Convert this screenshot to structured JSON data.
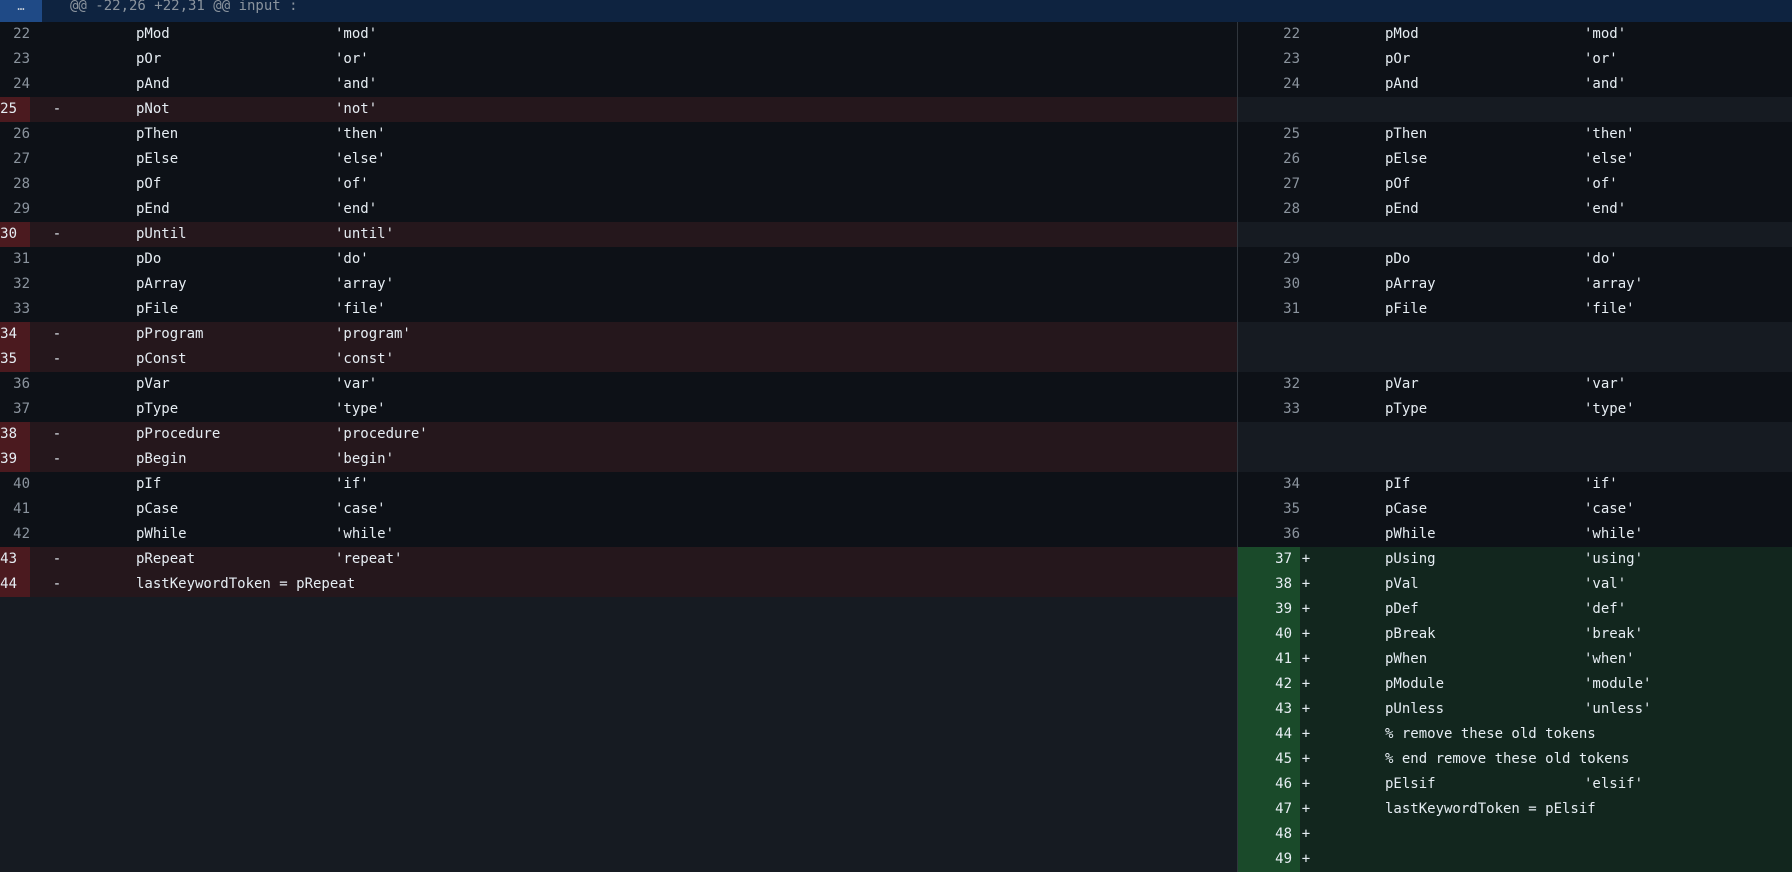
{
  "hunk": {
    "expand_icon": "…",
    "header": "@@ -22,26 +22,31 @@ input :"
  },
  "left": {
    "rows": [
      {
        "ln": "22",
        "mark": "",
        "tok": "pMod",
        "str": "'mod'",
        "type": "ctx"
      },
      {
        "ln": "23",
        "mark": "",
        "tok": "pOr",
        "str": "'or'",
        "type": "ctx"
      },
      {
        "ln": "24",
        "mark": "",
        "tok": "pAnd",
        "str": "'and'",
        "type": "ctx"
      },
      {
        "ln": "25",
        "mark": "-",
        "tok": "pNot",
        "str": "'not'",
        "type": "del"
      },
      {
        "ln": "26",
        "mark": "",
        "tok": "pThen",
        "str": "'then'",
        "type": "ctx"
      },
      {
        "ln": "27",
        "mark": "",
        "tok": "pElse",
        "str": "'else'",
        "type": "ctx"
      },
      {
        "ln": "28",
        "mark": "",
        "tok": "pOf",
        "str": "'of'",
        "type": "ctx"
      },
      {
        "ln": "29",
        "mark": "",
        "tok": "pEnd",
        "str": "'end'",
        "type": "ctx"
      },
      {
        "ln": "30",
        "mark": "-",
        "tok": "pUntil",
        "str": "'until'",
        "type": "del"
      },
      {
        "ln": "31",
        "mark": "",
        "tok": "pDo",
        "str": "'do'",
        "type": "ctx"
      },
      {
        "ln": "32",
        "mark": "",
        "tok": "pArray",
        "str": "'array'",
        "type": "ctx"
      },
      {
        "ln": "33",
        "mark": "",
        "tok": "pFile",
        "str": "'file'",
        "type": "ctx"
      },
      {
        "ln": "34",
        "mark": "-",
        "tok": "pProgram",
        "str": "'program'",
        "type": "del"
      },
      {
        "ln": "35",
        "mark": "-",
        "tok": "pConst",
        "str": "'const'",
        "type": "del"
      },
      {
        "ln": "36",
        "mark": "",
        "tok": "pVar",
        "str": "'var'",
        "type": "ctx"
      },
      {
        "ln": "37",
        "mark": "",
        "tok": "pType",
        "str": "'type'",
        "type": "ctx"
      },
      {
        "ln": "38",
        "mark": "-",
        "tok": "pProcedure",
        "str": "'procedure'",
        "type": "del"
      },
      {
        "ln": "39",
        "mark": "-",
        "tok": "pBegin",
        "str": "'begin'",
        "type": "del"
      },
      {
        "ln": "40",
        "mark": "",
        "tok": "pIf",
        "str": "'if'",
        "type": "ctx"
      },
      {
        "ln": "41",
        "mark": "",
        "tok": "pCase",
        "str": "'case'",
        "type": "ctx"
      },
      {
        "ln": "42",
        "mark": "",
        "tok": "pWhile",
        "str": "'while'",
        "type": "ctx"
      },
      {
        "ln": "43",
        "mark": "-",
        "tok": "pRepeat",
        "str": "'repeat'",
        "type": "del"
      },
      {
        "ln": "44",
        "mark": "-",
        "tok": "lastKeywordToken = pRepeat",
        "str": "",
        "type": "del"
      }
    ]
  },
  "right": {
    "rows": [
      {
        "ln": "22",
        "mark": "",
        "tok": "pMod",
        "str": "'mod'",
        "type": "ctx"
      },
      {
        "ln": "23",
        "mark": "",
        "tok": "pOr",
        "str": "'or'",
        "type": "ctx"
      },
      {
        "ln": "24",
        "mark": "",
        "tok": "pAnd",
        "str": "'and'",
        "type": "ctx"
      },
      {
        "ln": "",
        "mark": "",
        "tok": "",
        "str": "",
        "type": "empty"
      },
      {
        "ln": "25",
        "mark": "",
        "tok": "pThen",
        "str": "'then'",
        "type": "ctx"
      },
      {
        "ln": "26",
        "mark": "",
        "tok": "pElse",
        "str": "'else'",
        "type": "ctx"
      },
      {
        "ln": "27",
        "mark": "",
        "tok": "pOf",
        "str": "'of'",
        "type": "ctx"
      },
      {
        "ln": "28",
        "mark": "",
        "tok": "pEnd",
        "str": "'end'",
        "type": "ctx"
      },
      {
        "ln": "",
        "mark": "",
        "tok": "",
        "str": "",
        "type": "empty"
      },
      {
        "ln": "29",
        "mark": "",
        "tok": "pDo",
        "str": "'do'",
        "type": "ctx"
      },
      {
        "ln": "30",
        "mark": "",
        "tok": "pArray",
        "str": "'array'",
        "type": "ctx"
      },
      {
        "ln": "31",
        "mark": "",
        "tok": "pFile",
        "str": "'file'",
        "type": "ctx"
      },
      {
        "ln": "",
        "mark": "",
        "tok": "",
        "str": "",
        "type": "empty"
      },
      {
        "ln": "",
        "mark": "",
        "tok": "",
        "str": "",
        "type": "empty"
      },
      {
        "ln": "32",
        "mark": "",
        "tok": "pVar",
        "str": "'var'",
        "type": "ctx"
      },
      {
        "ln": "33",
        "mark": "",
        "tok": "pType",
        "str": "'type'",
        "type": "ctx"
      },
      {
        "ln": "",
        "mark": "",
        "tok": "",
        "str": "",
        "type": "empty"
      },
      {
        "ln": "",
        "mark": "",
        "tok": "",
        "str": "",
        "type": "empty"
      },
      {
        "ln": "34",
        "mark": "",
        "tok": "pIf",
        "str": "'if'",
        "type": "ctx"
      },
      {
        "ln": "35",
        "mark": "",
        "tok": "pCase",
        "str": "'case'",
        "type": "ctx"
      },
      {
        "ln": "36",
        "mark": "",
        "tok": "pWhile",
        "str": "'while'",
        "type": "ctx"
      },
      {
        "ln": "37",
        "mark": "+",
        "tok": "pUsing",
        "str": "'using'",
        "type": "add"
      },
      {
        "ln": "38",
        "mark": "+",
        "tok": "pVal",
        "str": "'val'",
        "type": "add"
      },
      {
        "ln": "39",
        "mark": "+",
        "tok": "pDef",
        "str": "'def'",
        "type": "add"
      },
      {
        "ln": "40",
        "mark": "+",
        "tok": "pBreak",
        "str": "'break'",
        "type": "add"
      },
      {
        "ln": "41",
        "mark": "+",
        "tok": "pWhen",
        "str": "'when'",
        "type": "add"
      },
      {
        "ln": "42",
        "mark": "+",
        "tok": "pModule",
        "str": "'module'",
        "type": "add"
      },
      {
        "ln": "43",
        "mark": "+",
        "tok": "pUnless",
        "str": "'unless'",
        "type": "add"
      },
      {
        "ln": "44",
        "mark": "+",
        "tok": "% remove these old tokens",
        "str": "",
        "type": "add"
      },
      {
        "ln": "45",
        "mark": "+",
        "tok": "% end remove these old tokens",
        "str": "",
        "type": "add"
      },
      {
        "ln": "46",
        "mark": "+",
        "tok": "pElsif",
        "str": "'elsif'",
        "type": "add"
      },
      {
        "ln": "47",
        "mark": "+",
        "tok": "lastKeywordToken = pElsif",
        "str": "",
        "type": "add"
      },
      {
        "ln": "48",
        "mark": "+",
        "tok": "",
        "str": "",
        "type": "add"
      },
      {
        "ln": "49",
        "mark": "+",
        "tok": "",
        "str": "",
        "type": "add"
      }
    ]
  },
  "colors": {
    "background": "#0d1117",
    "deleted_row": "#25171c",
    "deleted_gutter": "#4b1a1f",
    "added_row": "#12261e",
    "added_gutter": "#1a4a2a",
    "empty_row": "#161b22"
  }
}
